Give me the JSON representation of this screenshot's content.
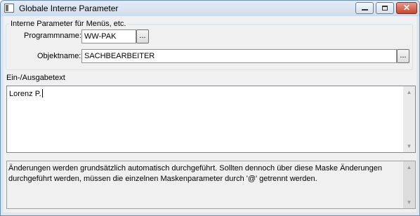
{
  "window": {
    "title": "Globale Interne Parameter",
    "close_glyph": "✕"
  },
  "group": {
    "legend": "Interne Parameter für Menüs, etc."
  },
  "programm": {
    "label": "Programmname:",
    "value": "WW-PAK",
    "browse_label": "..."
  },
  "objekt": {
    "label": "Objektname:",
    "value": "SACHBEARBEITER",
    "browse_label": "..."
  },
  "text_area": {
    "label": "Ein-/Ausgabetext",
    "value": "Lorenz P."
  },
  "info": {
    "text": "Änderungen werden grundsätzlich automatisch durchgeführt. Sollten dennoch über diese Maske Änderungen durchgeführt werden, müssen die einzelnen Maskenparameter durch '@' getrennt werden."
  },
  "scroll": {
    "up": "▲",
    "down": "▼"
  },
  "icons": {
    "app": "app-window-icon",
    "minimize": "minimize-icon",
    "maximize": "maximize-icon",
    "close": "close-icon"
  }
}
